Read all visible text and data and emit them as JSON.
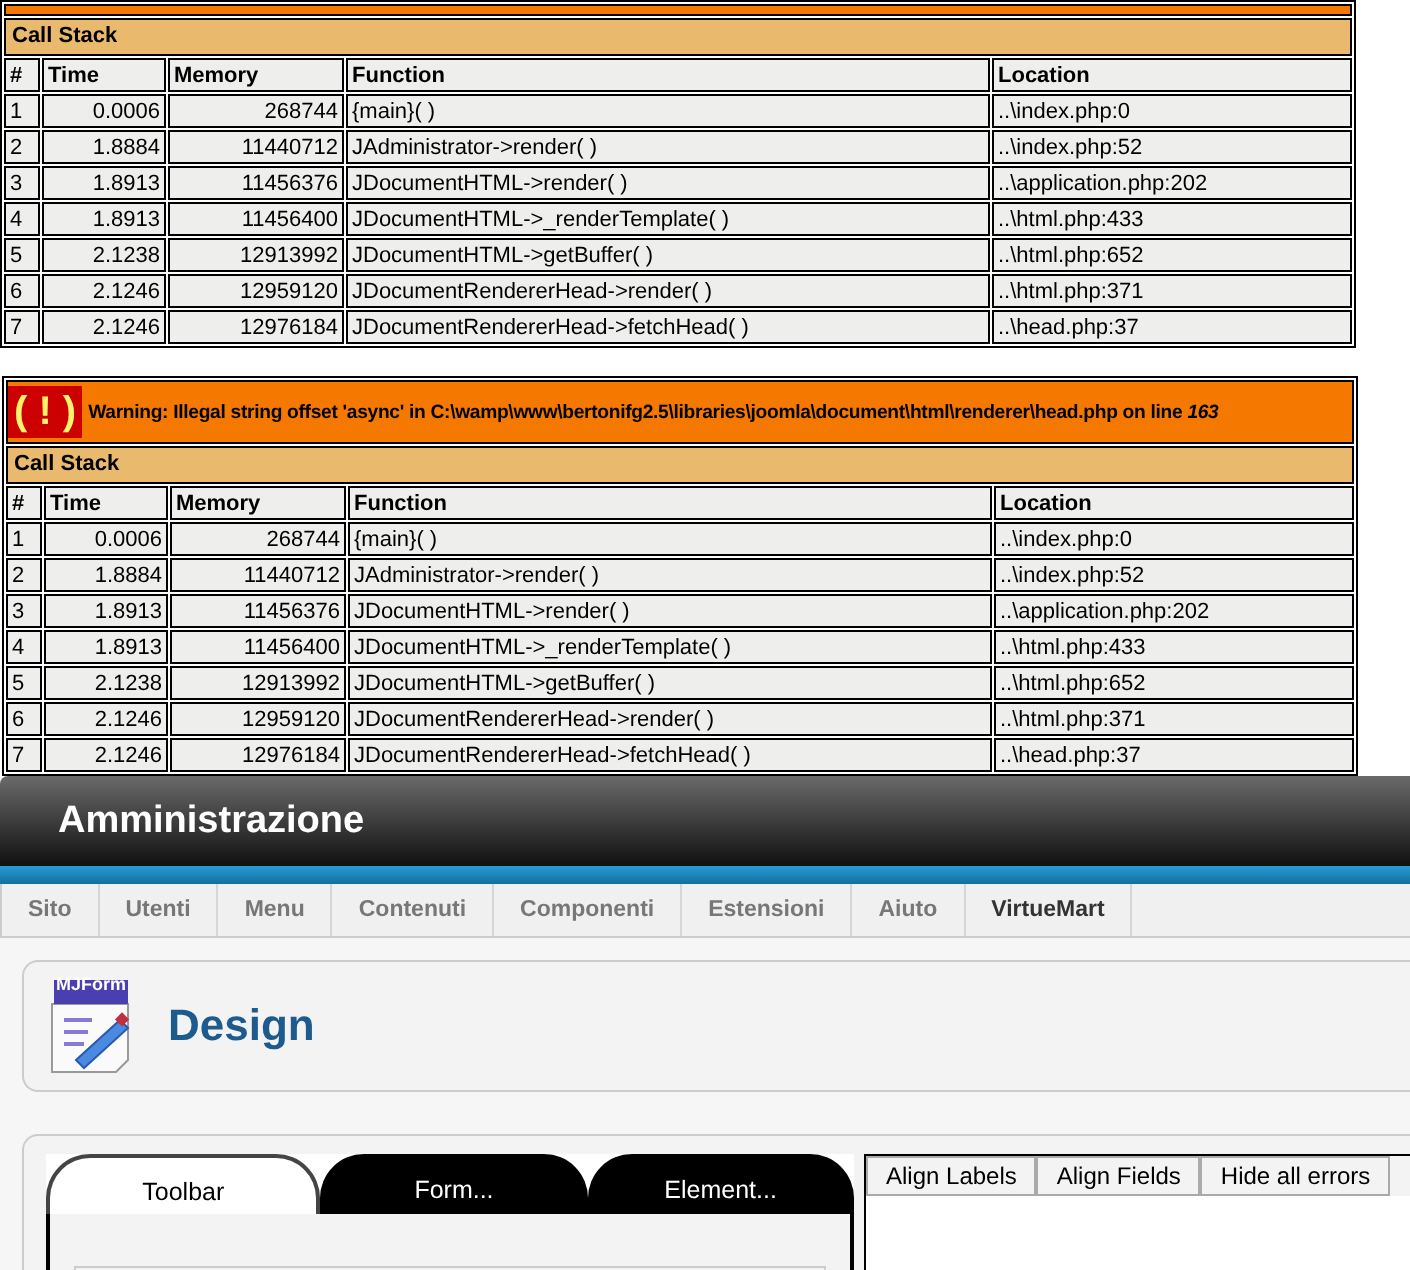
{
  "errors": [
    {
      "call_stack": {
        "title": "Call Stack",
        "columns": [
          "#",
          "Time",
          "Memory",
          "Function",
          "Location"
        ],
        "rows": [
          [
            "1",
            "0.0006",
            "268744",
            "{main}( )",
            "..\\index.php:0"
          ],
          [
            "2",
            "1.8884",
            "11440712",
            "JAdministrator->render( )",
            "..\\index.php:52"
          ],
          [
            "3",
            "1.8913",
            "11456376",
            "JDocumentHTML->render( )",
            "..\\application.php:202"
          ],
          [
            "4",
            "1.8913",
            "11456400",
            "JDocumentHTML->_renderTemplate( )",
            "..\\html.php:433"
          ],
          [
            "5",
            "2.1238",
            "12913992",
            "JDocumentHTML->getBuffer( )",
            "..\\html.php:652"
          ],
          [
            "6",
            "2.1246",
            "12959120",
            "JDocumentRendererHead->render( )",
            "..\\html.php:371"
          ],
          [
            "7",
            "2.1246",
            "12976184",
            "JDocumentRendererHead->fetchHead( )",
            "..\\head.php:37"
          ]
        ]
      }
    },
    {
      "icon": "( ! )",
      "warning": "Warning: Illegal string offset 'async' in C:\\wamp\\www\\bertonifg2.5\\libraries\\joomla\\document\\html\\renderer\\head.php on line *163*",
      "call_stack": {
        "title": "Call Stack",
        "columns": [
          "#",
          "Time",
          "Memory",
          "Function",
          "Location"
        ],
        "rows": [
          [
            "1",
            "0.0006",
            "268744",
            "{main}( )",
            "..\\index.php:0"
          ],
          [
            "2",
            "1.8884",
            "11440712",
            "JAdministrator->render( )",
            "..\\index.php:52"
          ],
          [
            "3",
            "1.8913",
            "11456376",
            "JDocumentHTML->render( )",
            "..\\application.php:202"
          ],
          [
            "4",
            "1.8913",
            "11456400",
            "JDocumentHTML->_renderTemplate( )",
            "..\\html.php:433"
          ],
          [
            "5",
            "2.1238",
            "12913992",
            "JDocumentHTML->getBuffer( )",
            "..\\html.php:652"
          ],
          [
            "6",
            "2.1246",
            "12959120",
            "JDocumentRendererHead->render( )",
            "..\\html.php:371"
          ],
          [
            "7",
            "2.1246",
            "12976184",
            "JDocumentRendererHead->fetchHead( )",
            "..\\head.php:37"
          ]
        ]
      }
    }
  ],
  "admin": {
    "title": "Amministrazione",
    "menu": [
      {
        "label": "Sito",
        "selected": false
      },
      {
        "label": "Utenti",
        "selected": false
      },
      {
        "label": "Menu",
        "selected": false
      },
      {
        "label": "Contenuti",
        "selected": false
      },
      {
        "label": "Componenti",
        "selected": false
      },
      {
        "label": "Estensioni",
        "selected": false
      },
      {
        "label": "Aiuto",
        "selected": false
      },
      {
        "label": "VirtueMart",
        "selected": true
      }
    ],
    "logo_text": "MJForm",
    "page_title": "Design",
    "tabs": [
      {
        "label": "Toolbar",
        "selected": true
      },
      {
        "label": "Form...",
        "selected": false
      },
      {
        "label": "Element...",
        "selected": false
      }
    ],
    "buttons": [
      "Align Labels",
      "Align Fields",
      "Hide all errors"
    ]
  }
}
